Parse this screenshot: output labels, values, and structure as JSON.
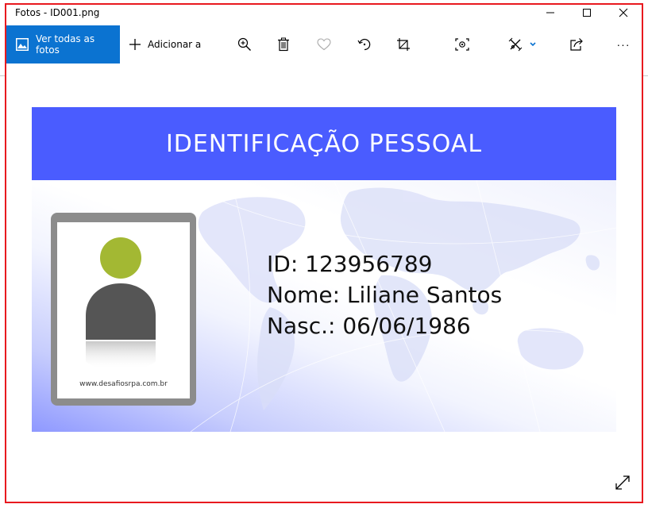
{
  "window": {
    "title": "Fotos - ID001.png"
  },
  "toolbar": {
    "view_all_label": "Ver todas as fotos",
    "add_to_label": "Adicionar a",
    "tools": [
      "zoom-in-icon",
      "delete-icon",
      "favorite-icon",
      "rotate-icon",
      "crop-icon",
      "enhance-icon",
      "edit-create-icon",
      "share-icon",
      "more-icon"
    ],
    "more_label": "···"
  },
  "card": {
    "title": "IDENTIFICAÇÃO PESSOAL",
    "id_line": "ID: 123956789",
    "name_line": "Nome: Liliane Santos",
    "birth_line": "Nasc.: 06/06/1986",
    "photo_url": "www.desafiosrpa.com.br"
  },
  "colors": {
    "accent": "#0b73d1",
    "card_header": "#4a5cff",
    "focus_outline": "#e8191f",
    "avatar_head": "#a3b833",
    "avatar_body": "#555555"
  }
}
